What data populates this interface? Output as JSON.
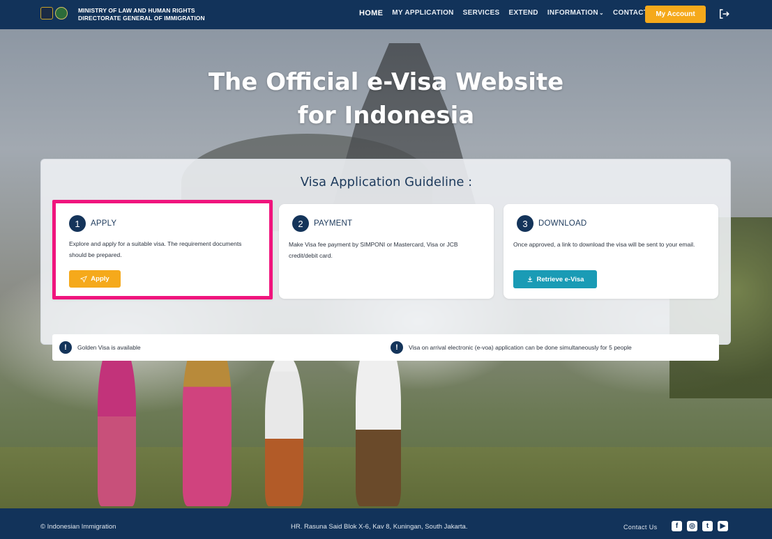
{
  "header": {
    "org_line1": "MINISTRY OF LAW AND HUMAN RIGHTS",
    "org_line2": "DIRECTORATE GENERAL OF IMMIGRATION",
    "nav": [
      "HOME",
      "MY APPLICATION",
      "SERVICES",
      "EXTEND",
      "INFORMATION",
      "CONTACT US"
    ],
    "account_button": "My Account",
    "logout_icon": "logout-icon"
  },
  "hero": {
    "title_line1": "The Official e-Visa Website",
    "title_line2": "for Indonesia"
  },
  "guideline": {
    "title": "Visa Application Guideline :",
    "steps": [
      {
        "number": "1",
        "label": "APPLY",
        "description": "Explore and apply for a suitable visa. The requirement documents should be prepared.",
        "button": "Apply",
        "icon": "send-icon"
      },
      {
        "number": "2",
        "label": "PAYMENT",
        "description": "Make Visa fee payment by SIMPONI or Mastercard, Visa or JCB credit/debit card."
      },
      {
        "number": "3",
        "label": "DOWNLOAD",
        "description": "Once approved, a link to download the visa will be sent to your email.",
        "button": "Retrieve e-Visa",
        "icon": "download-icon"
      }
    ],
    "notes": [
      "Golden Visa is available",
      "Visa on arrival electronic (e-voa) application can be done simultaneously for 5 people"
    ]
  },
  "footer": {
    "copyright": "© Indonesian Immigration",
    "address": "HR. Rasuna Said Blok X-6, Kav 8, Kuningan, South Jakarta.",
    "contact": "Contact Us",
    "socials": [
      "facebook-icon",
      "instagram-icon",
      "twitter-icon",
      "youtube-icon"
    ]
  },
  "colors": {
    "navy": "#12335a",
    "accent": "#f5a91b",
    "teal": "#1a9bb5",
    "highlight": "#f0147d"
  }
}
